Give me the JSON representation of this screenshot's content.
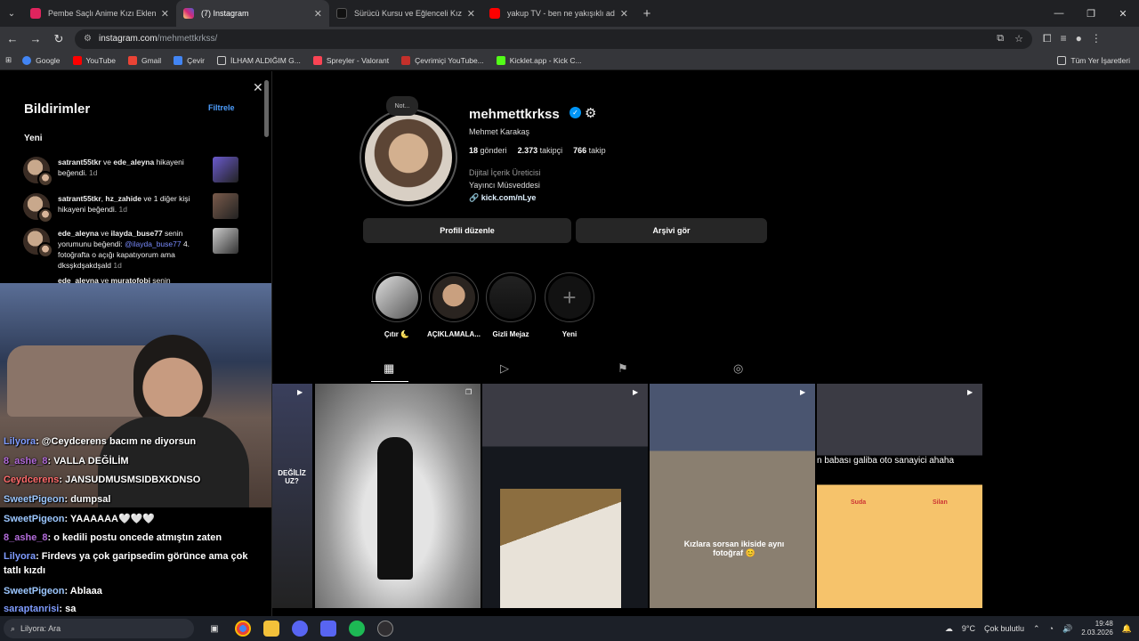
{
  "browser": {
    "tabs": [
      {
        "title": "Pembe Saçlı Anime Kızı Eklendi",
        "color": "#e0245e"
      },
      {
        "title": "(7) Instagram",
        "color": "#d6249f"
      },
      {
        "title": "Sürücü Kursu ve Eğlenceli Kızgı",
        "color": "#ffffff"
      },
      {
        "title": "yakup TV - ben ne yakışıklı ada",
        "color": "#ff0000"
      }
    ],
    "url_host": "instagram.com",
    "url_path": "/mehmettkrkss/",
    "bookmarks": [
      "Google",
      "YouTube",
      "Gmail",
      "Çevir",
      "İLHAM ALDIĞIM G...",
      "Spreyler - Valorant",
      "Çevrimiçi YouTube...",
      "Kicklet.app - Kick C..."
    ],
    "bookmarks_all": "Tüm Yer İşaretleri"
  },
  "notifications": {
    "title": "Bildirimler",
    "filter": "Filtrele",
    "section": "Yeni",
    "items": [
      {
        "user": "satrant55tkr",
        "text_1": " ve ",
        "user2": "ede_aleyna",
        "text_2": " hikayeni beğendi.",
        "time": "1d"
      },
      {
        "user": "satrant55tkr",
        "text_1": ", ",
        "user2": "hz_zahide",
        "text_2": " ve 1 diğer kişi hikayeni beğendi.",
        "time": "1d"
      },
      {
        "user": "ede_aleyna",
        "text_1": " ve ",
        "user2": "ilayda_buse77",
        "text_2": " senin yorumunu beğendi: ",
        "mention": "@ilayda_buse77",
        "text_3": " 4. fotoğrafta o açığı kapatıyorum ama dksşkdşakdşald",
        "time": "1d"
      },
      {
        "user": "ede_aleyna",
        "text_1": " ve ",
        "user2": "muratofobi",
        "text_2": " senin",
        "time": ""
      }
    ]
  },
  "chat": [
    {
      "nick": "Lilyora",
      "msg": ": @Ceydcerens bacım ne diyorsun"
    },
    {
      "nick": "8_ashe_8",
      "msg": ": VALLA DEĞİLİM"
    },
    {
      "nick": "Ceydcerens",
      "msg": ": JANSUDMUSMSIDBXKDNSO"
    },
    {
      "nick": "SweetPigeon",
      "msg": ": dumpsal"
    },
    {
      "nick": "SweetPigeon",
      "msg": ": YAAAAAA🤍🤍🤍"
    },
    {
      "nick": "8_ashe_8",
      "msg": ": o kedili postu oncede atmıştın zaten"
    },
    {
      "nick": "Lilyora",
      "msg": ": Firdevs ya çok garipsedim görünce ama çok"
    },
    {
      "nick": "",
      "msg": "tatlı kızdı"
    },
    {
      "nick": "SweetPigeon",
      "msg": ": Ablaaa"
    },
    {
      "nick": "saraptanrisi",
      "msg": ": sa"
    }
  ],
  "profile": {
    "note": "Not...",
    "username": "mehmettkrkss",
    "full_name": "Mehmet Karakaş",
    "posts_count": "18",
    "posts_label": "gönderi",
    "followers_count": "2.373",
    "followers_label": "takipçi",
    "following_count": "766",
    "following_label": "takip",
    "category": "Dijital İçerik Üreticisi",
    "bio": "Yayıncı Müsveddesi",
    "link": "kick.com/nLye",
    "edit_button": "Profili düzenle",
    "archive_button": "Arşivi gör",
    "highlights": [
      "Çıtır 🌜",
      "AÇIKLAMALA...",
      "Gizli Mejaz",
      "Yeni"
    ]
  },
  "grid_texts": {
    "left_cut": "DEĞİLİZ UZ?",
    "car_caption": "Kızlara sorsan ikiside aynı fotoğraf 😊",
    "top_caption": "n babası galiba oto sanayici ahaha",
    "name_1": "Suda",
    "name_2": "Silan"
  },
  "taskbar": {
    "search": "Lilyora: Ara",
    "weather": "9°C",
    "weather_desc": "Çok bulutlu",
    "time": "19:48",
    "date": "2.03.2026"
  }
}
